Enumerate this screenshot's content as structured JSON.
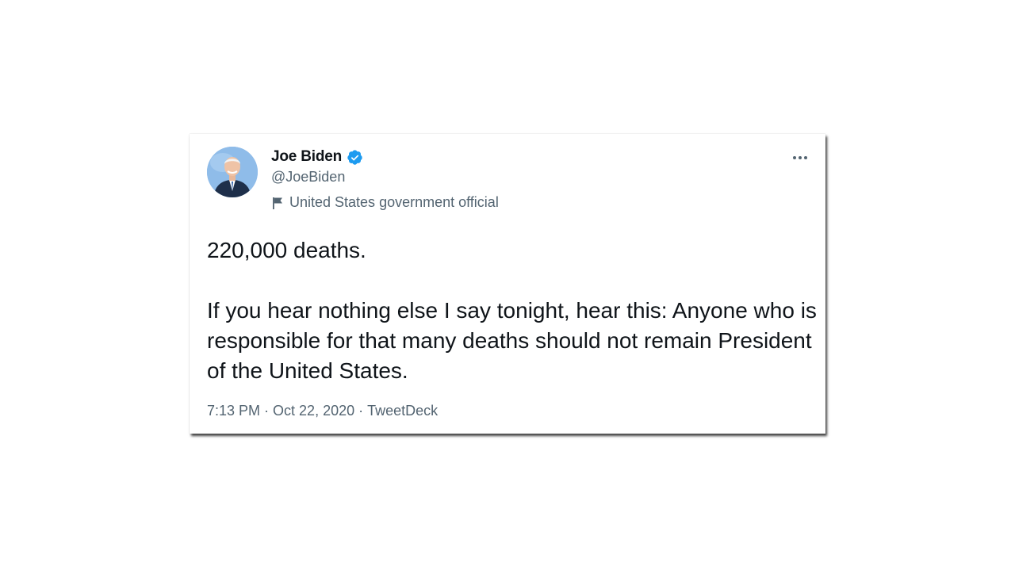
{
  "tweet": {
    "display_name": "Joe Biden",
    "handle": "@JoeBiden",
    "account_label": "United States government official",
    "text_paragraphs": [
      "220,000 deaths.",
      "If you hear nothing else I say tonight, hear this: Anyone who is responsible for that many deaths should not remain President of the United States."
    ],
    "time": "7:13 PM",
    "date": "Oct 22, 2020",
    "source": "TweetDeck",
    "separator": "·"
  },
  "icons": {
    "verified": "verified-badge-icon",
    "label": "flag-icon",
    "more": "more-options-icon"
  },
  "colors": {
    "verified_blue": "#1d9bf0",
    "text_primary": "#0f1419",
    "text_secondary": "#536471"
  }
}
